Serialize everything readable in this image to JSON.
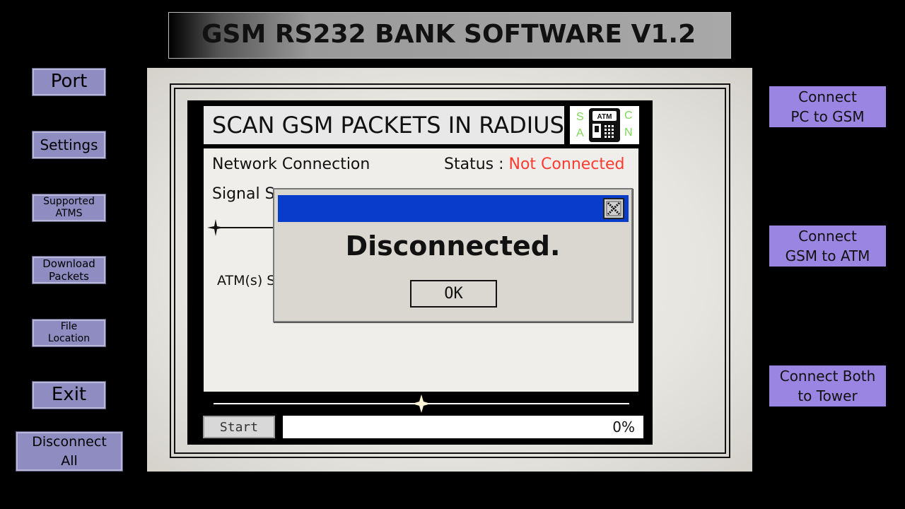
{
  "app": {
    "title": "GSM RS232 BANK SOFTWARE V1.2"
  },
  "sidebar": {
    "items": [
      {
        "label": "Port"
      },
      {
        "label": "Settings"
      },
      {
        "label": "Supported\nATMS"
      },
      {
        "label": "Download\nPackets"
      },
      {
        "label": "File\nLocation"
      },
      {
        "label": "Exit"
      },
      {
        "label": "Disconnect\nAll"
      }
    ]
  },
  "right_actions": [
    {
      "label": "Connect\nPC to GSM"
    },
    {
      "label": "Connect\nGSM to ATM"
    },
    {
      "label": "Connect Both\nto Tower"
    }
  ],
  "scanner": {
    "title": "SCAN GSM PACKETS IN RADIUS",
    "logo": {
      "letters": [
        "S",
        "A",
        "C",
        "N"
      ],
      "atm_text": "ATM",
      "color": "#7ed957"
    },
    "network_label": "Network Connection",
    "status_label": "Status :",
    "status_value": "Not Connected",
    "status_color": "#ff3b30",
    "signal_label": "Signal S",
    "atm_label": "ATM(s) S",
    "start_label": "Start",
    "progress_percent": 0,
    "progress_text": "0%"
  },
  "dialog": {
    "message": "Disconnected.",
    "ok_label": "OK",
    "titlebar_color": "#0a3ccc"
  },
  "colors": {
    "sidebar_button": "#8e8cc0",
    "right_button": "#9a86e2"
  }
}
